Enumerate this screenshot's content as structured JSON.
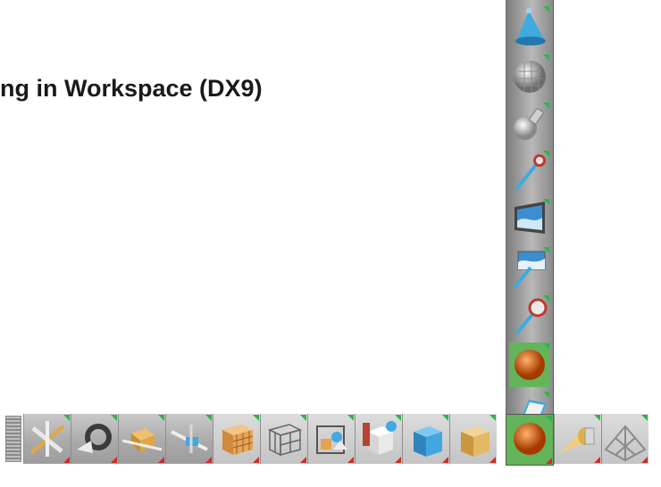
{
  "heading": {
    "title": "ng in Workspace (DX9)"
  },
  "vertical_palette": {
    "tools": [
      {
        "icon": "spotlight-cone-icon"
      },
      {
        "icon": "checker-sphere-icon"
      },
      {
        "icon": "point-light-bulb-icon"
      },
      {
        "icon": "light-probe-icon"
      },
      {
        "icon": "background-image-panel-icon"
      },
      {
        "icon": "image-probe-icon"
      },
      {
        "icon": "probe-pointer-icon"
      },
      {
        "icon": "orange-sphere-icon"
      },
      {
        "icon": "flat-plane-icon"
      }
    ]
  },
  "horizontal_palette": {
    "tools": [
      {
        "icon": "axis-gizmo-icon"
      },
      {
        "icon": "rotate-gizmo-icon"
      },
      {
        "icon": "translate-cube-icon"
      },
      {
        "icon": "move-tool-icon"
      },
      {
        "icon": "grid-box-icon"
      },
      {
        "icon": "wireframe-box-icon"
      },
      {
        "icon": "scene-objects-icon"
      },
      {
        "icon": "white-cube-icon"
      },
      {
        "icon": "blue-cube-icon"
      },
      {
        "icon": "tan-cube-icon"
      },
      {
        "icon": "orange-sphere-icon"
      },
      {
        "icon": "light-cone-icon"
      },
      {
        "icon": "wire-plane-icon"
      }
    ]
  },
  "colors": {
    "accent_green": "#2db54a",
    "accent_red": "#d12a2a",
    "palette_gray": "#a9a9a9"
  }
}
